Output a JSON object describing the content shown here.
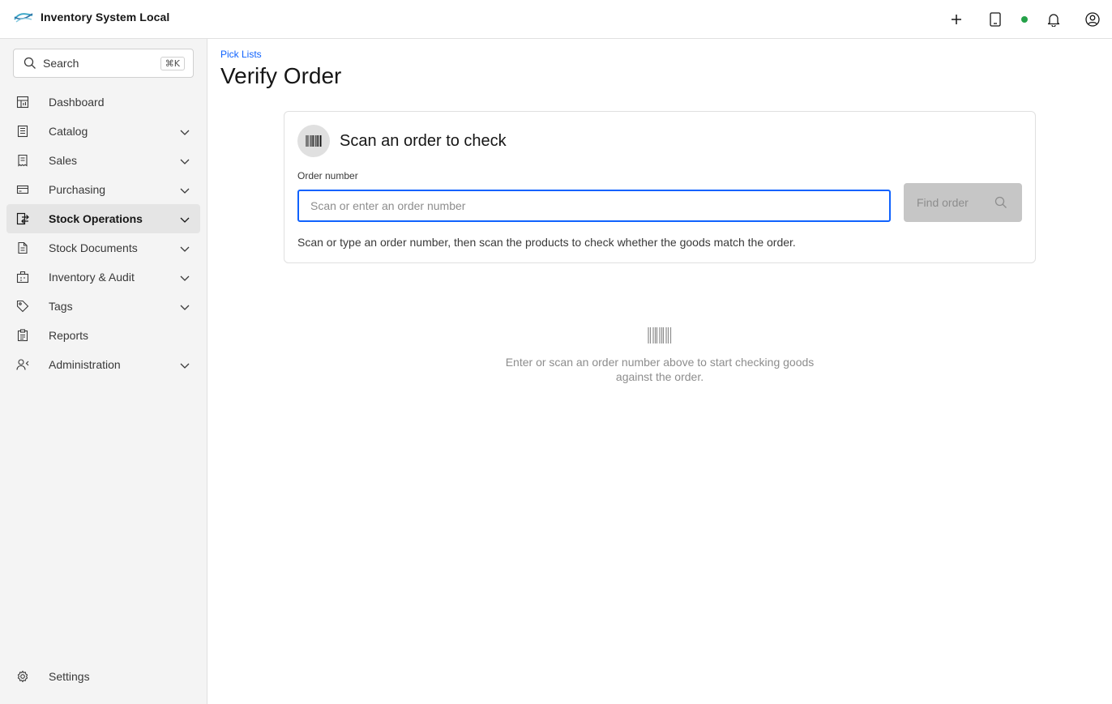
{
  "app": {
    "title": "Inventory System Local"
  },
  "header": {
    "add_icon": "plus-icon",
    "device_icon": "tablet-icon",
    "status_color": "#24a148",
    "notifications_icon": "bell-icon",
    "user_icon": "user-avatar-icon"
  },
  "sidebar": {
    "search": {
      "label": "Search",
      "shortcut": "⌘K"
    },
    "items": [
      {
        "label": "Dashboard",
        "icon": "dashboard-icon",
        "expandable": false
      },
      {
        "label": "Catalog",
        "icon": "catalog-icon",
        "expandable": true
      },
      {
        "label": "Sales",
        "icon": "receipt-icon",
        "expandable": true
      },
      {
        "label": "Purchasing",
        "icon": "card-icon",
        "expandable": true
      },
      {
        "label": "Stock Operations",
        "icon": "transfer-icon",
        "expandable": true,
        "active": true
      },
      {
        "label": "Stock Documents",
        "icon": "document-icon",
        "expandable": true
      },
      {
        "label": "Inventory & Audit",
        "icon": "inventory-icon",
        "expandable": true
      },
      {
        "label": "Tags",
        "icon": "tag-icon",
        "expandable": true
      },
      {
        "label": "Reports",
        "icon": "report-icon",
        "expandable": false
      },
      {
        "label": "Administration",
        "icon": "user-admin-icon",
        "expandable": true
      }
    ],
    "settings": {
      "label": "Settings",
      "icon": "gear-icon"
    }
  },
  "main": {
    "breadcrumb": "Pick Lists",
    "title": "Verify Order",
    "card": {
      "title": "Scan an order to check",
      "icon": "barcode-icon",
      "field_label": "Order number",
      "input_value": "",
      "input_placeholder": "Scan or enter an order number",
      "button_label": "Find order",
      "button_icon": "search-icon",
      "helper": "Scan or type an order number, then scan the products to check whether the goods match the order."
    },
    "empty_state": {
      "icon": "barcode-icon",
      "text": "Enter or scan an order number above to start checking goods against the order."
    }
  },
  "colors": {
    "accent": "#0f62fe",
    "sidebar_bg": "#f4f4f4",
    "active_item_bg": "#e5e5e5",
    "disabled_button_bg": "#c6c6c6",
    "status_online": "#24a148"
  }
}
